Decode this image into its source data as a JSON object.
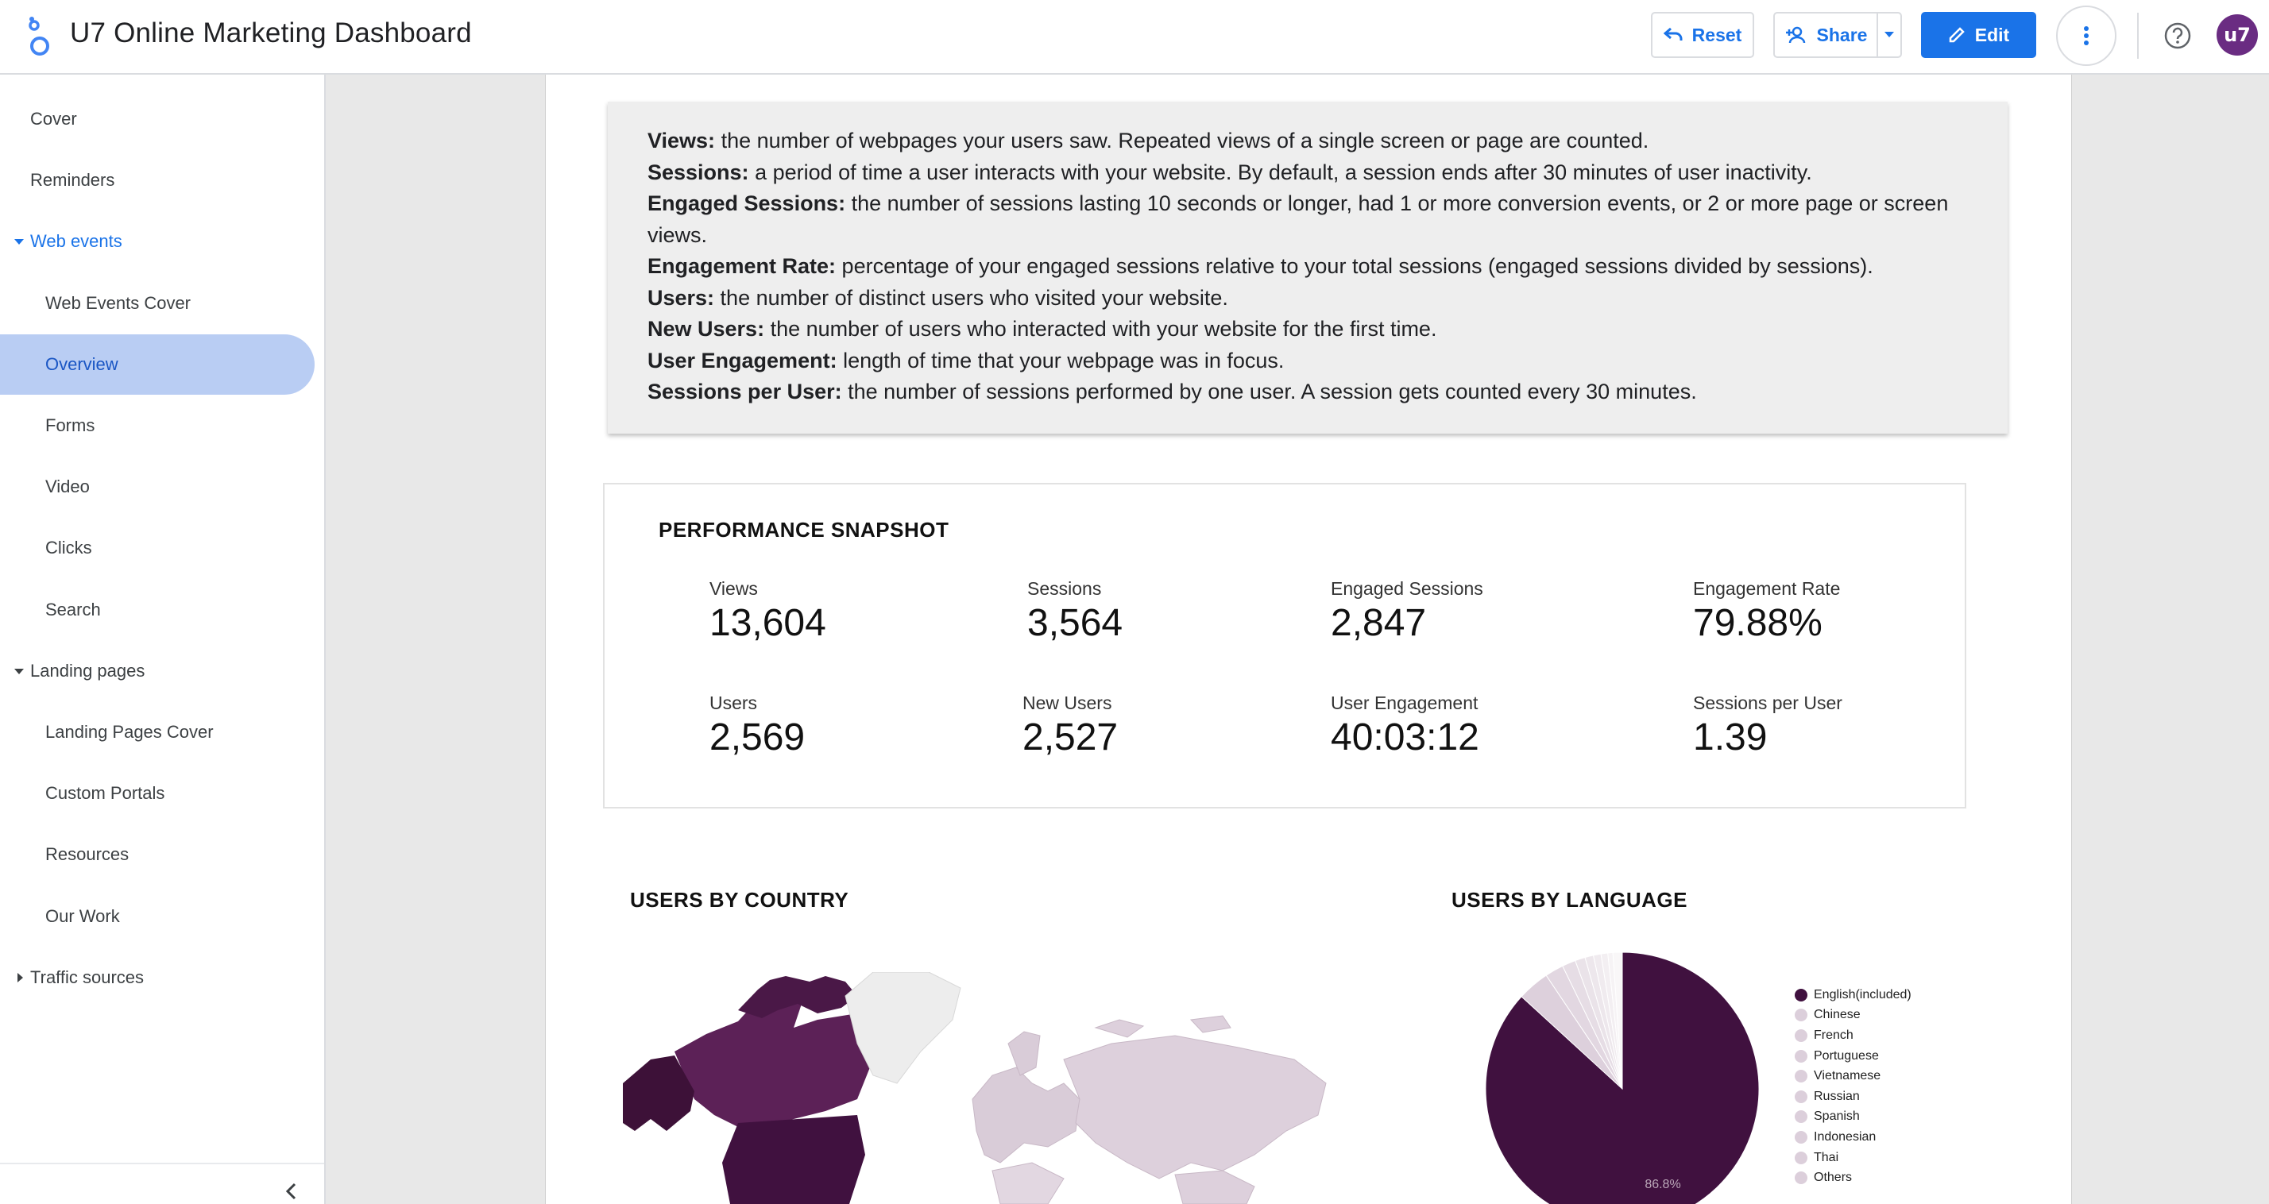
{
  "header": {
    "title": "U7 Online Marketing Dashboard",
    "reset_label": "Reset",
    "share_label": "Share",
    "edit_label": "Edit",
    "avatar_text": "u7"
  },
  "sidebar": {
    "items": [
      {
        "label": "Cover",
        "level": 1
      },
      {
        "label": "Reminders",
        "level": 1
      },
      {
        "label": "Web events",
        "level": 1,
        "expanded": true
      },
      {
        "label": "Web Events Cover",
        "level": 2
      },
      {
        "label": "Overview",
        "level": 2,
        "active": true
      },
      {
        "label": "Forms",
        "level": 2
      },
      {
        "label": "Video",
        "level": 2
      },
      {
        "label": "Clicks",
        "level": 2
      },
      {
        "label": "Search",
        "level": 2
      },
      {
        "label": "Landing pages",
        "level": 1,
        "expanded": true
      },
      {
        "label": "Landing Pages Cover",
        "level": 2
      },
      {
        "label": "Custom Portals",
        "level": 2
      },
      {
        "label": "Resources",
        "level": 2
      },
      {
        "label": "Our Work",
        "level": 2
      },
      {
        "label": "Traffic sources",
        "level": 1,
        "expanded": false
      }
    ]
  },
  "definitions": [
    {
      "term": "Views:",
      "text": " the number of webpages your users saw. Repeated views of a single screen or page are counted."
    },
    {
      "term": "Sessions:",
      "text": " a period of time a user interacts with your website. By default, a session ends after 30 minutes of user inactivity."
    },
    {
      "term": "Engaged Sessions:",
      "text": " the number of sessions lasting 10 seconds or longer, had 1 or more conversion events, or 2 or more page or screen views."
    },
    {
      "term": "Engagement Rate:",
      "text": " percentage of your engaged sessions relative to your total sessions (engaged sessions divided by sessions)."
    },
    {
      "term": "Users:",
      "text": " the number of distinct users who visited your website."
    },
    {
      "term": "New Users:",
      "text": " the number of users who interacted with your website for the first time."
    },
    {
      "term": "User Engagement:",
      "text": " length of time that your webpage was in focus."
    },
    {
      "term": "Sessions per User:",
      "text": " the number of sessions performed by one user. A session gets counted every 30 minutes."
    }
  ],
  "snapshot": {
    "title": "PERFORMANCE SNAPSHOT",
    "metrics": [
      {
        "label": "Views",
        "value": "13,604"
      },
      {
        "label": "Sessions",
        "value": "3,564"
      },
      {
        "label": "Engaged Sessions",
        "value": "2,847"
      },
      {
        "label": "Engagement Rate",
        "value": "79.88%"
      },
      {
        "label": "Users",
        "value": "2,569"
      },
      {
        "label": "New Users",
        "value": "2,527"
      },
      {
        "label": "User Engagement",
        "value": "40:03:12"
      },
      {
        "label": "Sessions per User",
        "value": "1.39"
      }
    ]
  },
  "country_section": {
    "title": "USERS BY COUNTRY"
  },
  "language_section": {
    "title": "USERS BY LANGUAGE"
  },
  "chart_data": {
    "type": "pie",
    "slice_label": "86.8%",
    "categories": [
      "English(included)",
      "Chinese",
      "French",
      "Portuguese",
      "Vietnamese",
      "Russian",
      "Spanish",
      "Indonesian",
      "Thai",
      "Others"
    ],
    "values": [
      86.8,
      3.8,
      2.2,
      1.6,
      1.2,
      1.0,
      0.9,
      0.8,
      0.6,
      1.1
    ],
    "colors": [
      "#40113f",
      "#ddd0dc",
      "#e2d7e1",
      "#e6dde5",
      "#eae3e9",
      "#ede7ec",
      "#f0ebef",
      "#f3eff2",
      "#f6f3f5",
      "#f9f7f8"
    ]
  },
  "colors": {
    "accent": "#1a73e8",
    "active_nav": "#b9cdf3",
    "map_dark": "#5a2055",
    "map_light": "#d9ccd8"
  }
}
